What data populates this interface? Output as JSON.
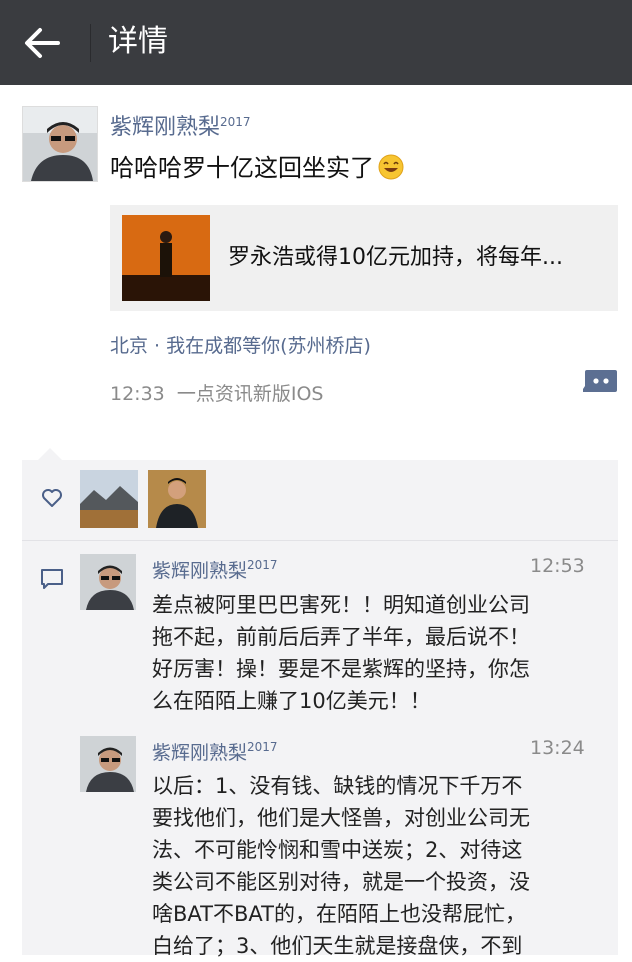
{
  "header": {
    "title": "详情",
    "back_icon": "arrow-left-icon"
  },
  "post": {
    "username": "紫辉刚熟梨",
    "username_sup": "2017",
    "text": "哈哈哈罗十亿这回坐实了",
    "emoji_icon": "grin-emoji-icon",
    "link": {
      "title": "罗永浩或得10亿元加持，将每年..."
    },
    "location": "北京 · 我在成都等你(苏州桥店)",
    "time": "12:33",
    "source": "一点资讯新版IOS"
  },
  "likes": {
    "icon": "heart-icon",
    "count_shown": 2
  },
  "comments": [
    {
      "username": "紫辉刚熟梨",
      "username_sup": "2017",
      "time": "12:53",
      "lines": [
        "差点被阿里巴巴害死！！明知道创业公司",
        "拖不起，前前后后弄了半年，最后说不！",
        "好厉害！操！要是不是紫辉的坚持，你怎",
        "么在陌陌上赚了10亿美元！！"
      ]
    },
    {
      "username": "紫辉刚熟梨",
      "username_sup": "2017",
      "time": "13:24",
      "lines": [
        "以后：1、没有钱、缺钱的情况下千万不",
        "要找他们，他们是大怪兽，对创业公司无",
        "法、不可能怜悯和雪中送炭；2、对待这",
        "类公司不能区别对待，就是一个投资，没",
        "啥BAT不BAT的，在陌陌上也没帮屁忙，",
        "白给了；3、他们天生就是接盘侠，不到"
      ]
    }
  ],
  "colors": {
    "topbar": "#3a3c40",
    "name_link": "#586b8f",
    "comment_bg": "#f3f3f5"
  }
}
